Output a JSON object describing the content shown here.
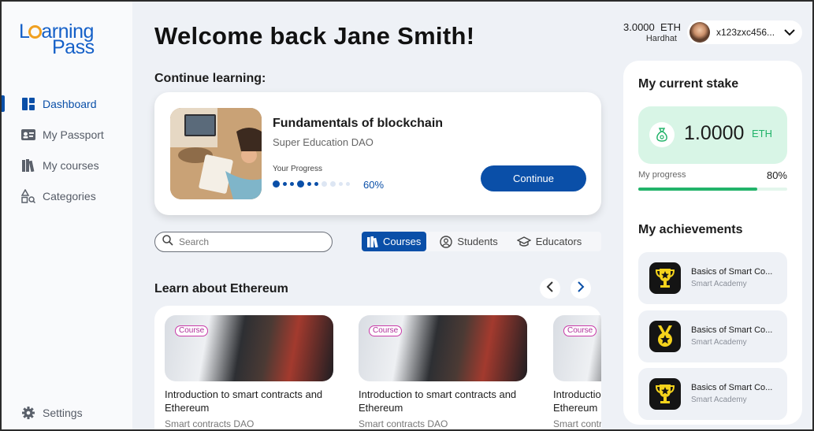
{
  "logo": {
    "line1_pre": "L",
    "line1_post": "arning",
    "line2": "Pass"
  },
  "sidebar": {
    "items": [
      {
        "label": "Dashboard",
        "icon": "dashboard-icon",
        "active": true
      },
      {
        "label": "My Passport",
        "icon": "passport-icon",
        "active": false
      },
      {
        "label": "My courses",
        "icon": "books-icon",
        "active": false
      },
      {
        "label": "Categories",
        "icon": "categories-icon",
        "active": false
      }
    ],
    "settings_label": "Settings"
  },
  "header": {
    "welcome": "Welcome back Jane Smith!"
  },
  "continue_learning": {
    "section_title": "Continue learning:",
    "course_title": "Fundamentals of blockchain",
    "provider": "Super Education DAO",
    "progress_label": "Your Progress",
    "progress_value": "60%",
    "progress_fraction": 0.6,
    "button_label": "Continue"
  },
  "search": {
    "placeholder": "Search",
    "value": ""
  },
  "tabs": [
    {
      "label": "Courses",
      "icon": "courses-icon",
      "active": true
    },
    {
      "label": "Students",
      "icon": "students-icon",
      "active": false
    },
    {
      "label": "Educators",
      "icon": "educators-icon",
      "active": false
    }
  ],
  "learn_section": {
    "title": "Learn about Ethereum",
    "courses": [
      {
        "tag": "Course",
        "title": "Introduction to smart contracts and Ethereum",
        "provider": "Smart contracts DAO"
      },
      {
        "tag": "Course",
        "title": "Introduction to smart contracts and Ethereum",
        "provider": "Smart contracts DAO"
      },
      {
        "tag": "Course",
        "title": "Introduction to smart contracts and Ethereum",
        "provider": "Smart contracts DAO"
      }
    ]
  },
  "account": {
    "balance": "3.0000  ETH",
    "network": "Hardhat",
    "address": "x123zxc456..."
  },
  "stake": {
    "title": "My current stake",
    "value": "1.0000",
    "unit": "ETH",
    "progress_label": "My progress",
    "progress_value": "80%",
    "progress_fraction": 0.8
  },
  "achievements": {
    "title": "My achievements",
    "items": [
      {
        "title": "Basics of Smart Co...",
        "provider": "Smart Academy",
        "icon": "trophy-icon"
      },
      {
        "title": "Basics of Smart Co...",
        "provider": "Smart Academy",
        "icon": "medal-icon"
      },
      {
        "title": "Basics of Smart Co...",
        "provider": "Smart Academy",
        "icon": "trophy-icon"
      }
    ]
  },
  "colors": {
    "primary": "#0a4fa8",
    "success": "#22b36a",
    "logo_accent": "#f0a020",
    "tag": "#c93aa8"
  }
}
